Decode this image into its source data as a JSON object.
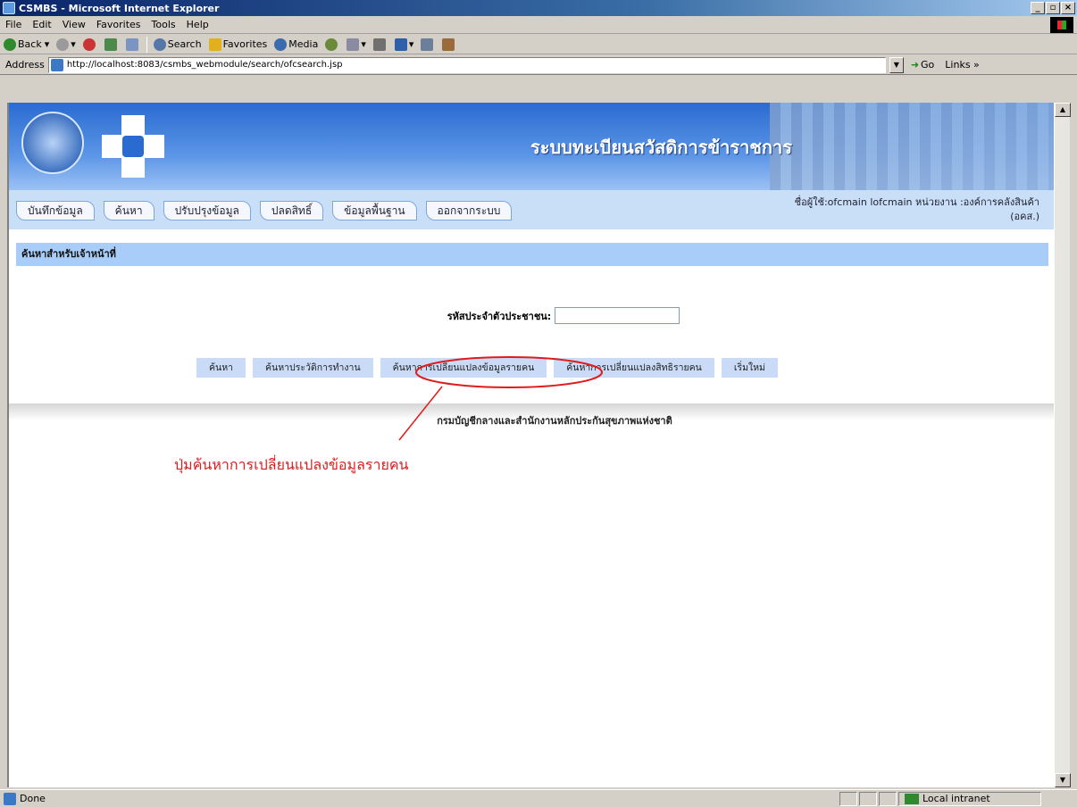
{
  "window": {
    "title": "CSMBS - Microsoft Internet Explorer",
    "minimize": "_",
    "maximize": "▫",
    "close": "×"
  },
  "menu": [
    "File",
    "Edit",
    "View",
    "Favorites",
    "Tools",
    "Help"
  ],
  "toolbar": {
    "back": "Back",
    "search": "Search",
    "favorites": "Favorites",
    "media": "Media"
  },
  "address": {
    "label": "Address",
    "url": "http://localhost:8083/csmbs_webmodule/search/ofcsearch.jsp",
    "go": "Go",
    "links": "Links »"
  },
  "banner": {
    "system_title": "ระบบทะเบียนสวัสดิการข้าราชการ"
  },
  "nav": {
    "tabs": [
      "บันทึกข้อมูล",
      "ค้นหา",
      "ปรับปรุงข้อมูล",
      "ปลดสิทธิ์",
      "ข้อมูลพื้นฐาน",
      "ออกจากระบบ"
    ],
    "user_line1": "ชื่อผู้ใช้:ofcmain lofcmain  หน่วยงาน :องค์การคลังสินค้า",
    "user_line2": "(อคส.)"
  },
  "section": {
    "title": "ค้นหาสำหรับเจ้าหน้าที่"
  },
  "search": {
    "label": "รหัสประจำตัวประชาชน:",
    "value": ""
  },
  "buttons": [
    "ค้นหา",
    "ค้นหาประวัติการทำงาน",
    "ค้นหาการเปลี่ยนแปลงข้อมูลรายคน",
    "ค้นหาการเปลี่ยนแปลงสิทธิรายคน",
    "เริ่มใหม่"
  ],
  "footer": {
    "text": "กรมบัญชีกลางและสำนักงานหลักประกันสุขภาพแห่งชาติ"
  },
  "annotation": {
    "text": "ปุ่มค้นหาการเปลี่ยนแปลงข้อมูลรายคน",
    "color": "#e01b1b"
  },
  "status": {
    "text": "Done",
    "zone": "Local intranet"
  }
}
